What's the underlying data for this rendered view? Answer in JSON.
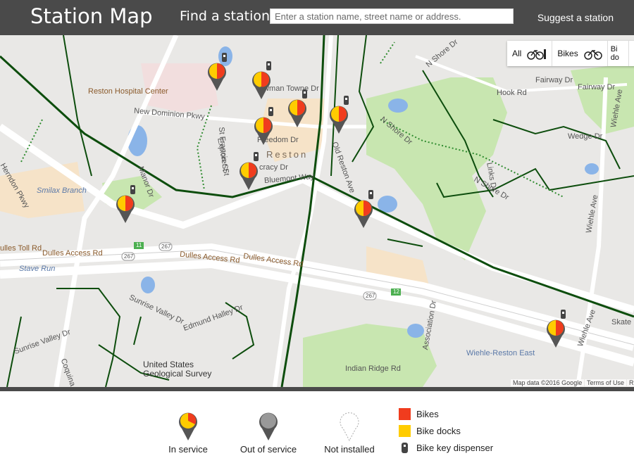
{
  "header": {
    "title": "Station Map",
    "find_label": "Find a station",
    "search_placeholder": "Enter a station name, street name or address.",
    "suggest_link": "Suggest a station"
  },
  "filter": {
    "all": "All",
    "bikes": "Bikes",
    "docks_partial": "Bi do"
  },
  "map_labels": {
    "reston_hospital": "Reston Hospital Center",
    "new_dominion": "New Dominion Pkwy",
    "freedom_dr": "Freedom Dr",
    "reston": "Reston",
    "bluemont": "Bluemont Way",
    "explorer": "Explorer St",
    "st_francis": "St Francis St",
    "democracy": "cracy Dr",
    "bowman": "owman Towne Dr",
    "smilax": "Smilax Branch",
    "herndon": "Herndon Pkwy",
    "dulles_toll": "ulles Toll Rd",
    "dulles_access_1": "Dulles Access Rd",
    "dulles_access_2": "Dulles Access Rd",
    "dulles_access_3": "Dulles Access Rd",
    "stave_run": "Stave Run",
    "sunrise_valley_1": "Sunrise Valley Dr",
    "sunrise_valley_2": "Sunrise Valley Dr",
    "edmund_halley": "Edmund Halley Dr",
    "usgs": "United States Geological Survey",
    "coquina": "Coquina Dr",
    "indian_ridge": "Indian Ridge Rd",
    "association": "Association Dr",
    "wiehle_reston_east": "Wiehle-Reston East",
    "n_shore": "N Shore Dr",
    "n_shore_2": "N Shore Dr",
    "n_shore_top": "N Shore Dr",
    "hook_rd": "Hook Rd",
    "fairway_dr": "Fairway Dr",
    "fairway_dr_2": "Fairway Dr",
    "wedge_dr": "Wedge Dr",
    "links_dr": "Links Dr",
    "wiehle_ave_1": "Wiehle Ave",
    "wiehle_ave_2": "Wiehle Ave",
    "wiehle_ave_3": "Wiehle Ave",
    "old_reston": "Old Reston Ave",
    "skate": "Skate",
    "manor": "Manor Dr",
    "shield_11": "11",
    "shield_12": "12",
    "shield_267a": "267",
    "shield_267b": "267",
    "shield_267c": "267"
  },
  "attribution": {
    "map_data": "Map data ©2016 Google",
    "terms": "Terms of Use",
    "report": "R"
  },
  "legend": {
    "in_service": "In service",
    "out_of_service": "Out of service",
    "not_installed": "Not installed",
    "bikes": "Bikes",
    "bike_docks": "Bike docks",
    "key_dispenser": "Bike key dispenser"
  },
  "colors": {
    "header_bg": "#4a4a4a",
    "bikes": "#f03c1e",
    "docks": "#ffcc00",
    "trail": "#0d4d0d",
    "park": "#c8e6b0",
    "road": "#ffffff",
    "out_of_service": "#999999"
  },
  "icons": {
    "in_service_marker": "map-pin-icon",
    "key": "key-dispenser-icon",
    "bike": "bicycle-icon",
    "dock": "dock-icon"
  }
}
